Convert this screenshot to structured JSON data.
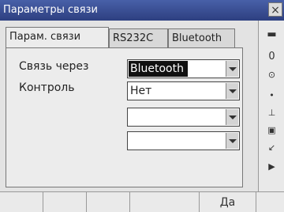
{
  "window": {
    "title": "Параметры связи",
    "close_label": "×"
  },
  "tabs": [
    {
      "label": "Парам. связи",
      "active": true
    },
    {
      "label": "RS232C",
      "active": false
    },
    {
      "label": "Bluetooth",
      "active": false
    }
  ],
  "form": {
    "connection_via": {
      "label": "Связь через",
      "value": "Bluetooth"
    },
    "control": {
      "label": "Контроль",
      "value": "Нет"
    },
    "empty_field_1": {
      "value": ""
    },
    "empty_field_2": {
      "value": ""
    }
  },
  "status_icons": [
    {
      "name": "battery-icon",
      "glyph": "▬"
    },
    {
      "name": "prism-constant-icon",
      "glyph": "0"
    },
    {
      "name": "target-icon",
      "glyph": "⊙"
    },
    {
      "name": "dot-icon",
      "glyph": "•"
    },
    {
      "name": "level-icon",
      "glyph": "⊥"
    },
    {
      "name": "memory-icon",
      "glyph": "▣"
    },
    {
      "name": "signal-icon",
      "glyph": "↙"
    },
    {
      "name": "laser-icon",
      "glyph": "▶"
    }
  ],
  "softkeys": [
    "",
    "",
    "",
    "",
    "Да",
    ""
  ]
}
